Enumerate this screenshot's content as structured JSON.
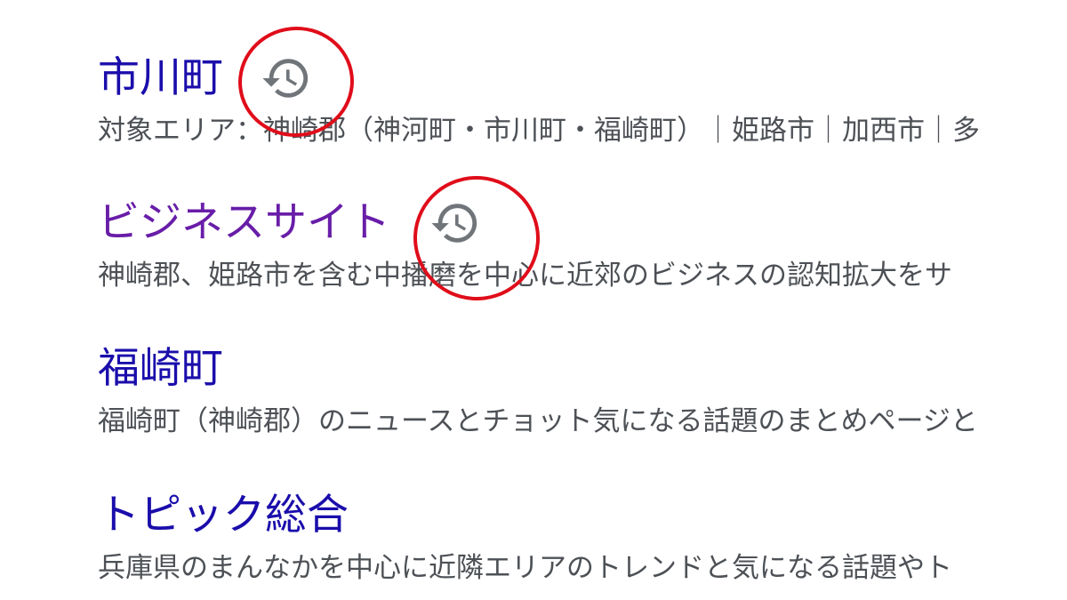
{
  "results": [
    {
      "title": "市川町",
      "visited": false,
      "snippet": "対象エリア：神崎郡（神河町・市川町・福崎町）｜姫路市｜加西市｜多",
      "icon": "history-icon"
    },
    {
      "title": "ビジネスサイト",
      "visited": true,
      "snippet": "神崎郡、姫路市を含む中播磨を中心に近郊のビジネスの認知拡大をサ",
      "icon": "history-icon"
    },
    {
      "title": "福崎町",
      "visited": false,
      "snippet": "福崎町（神崎郡）のニュースとチョット気になる話題のまとめページと",
      "icon": null
    },
    {
      "title": "トピック総合",
      "visited": false,
      "snippet": "兵庫県のまんなかを中心に近隣エリアのトレンドと気になる話題やト",
      "icon": null
    }
  ],
  "colors": {
    "link": "#1a0dab",
    "visited_link": "#681da8",
    "snippet_text": "#4d5156",
    "icon": "#70757a",
    "annotation": "#e00d1a"
  }
}
